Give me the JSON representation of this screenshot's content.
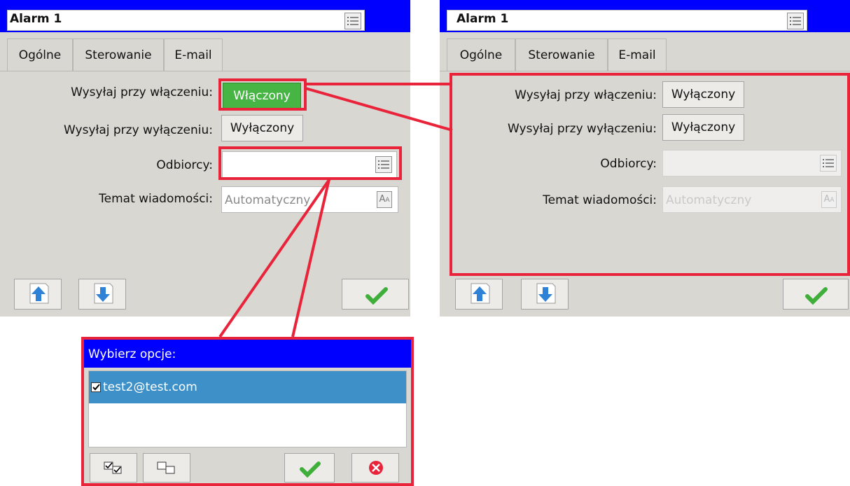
{
  "left_panel": {
    "title": "Alarm 1",
    "tabs": [
      "Ogólne",
      "Sterowanie",
      "E-mail"
    ],
    "active_tab": "E-mail",
    "fields": {
      "send_on_label": "Wysyłaj przy włączeniu:",
      "send_on_value": "Włączony",
      "send_off_label": "Wysyłaj przy wyłączeniu:",
      "send_off_value": "Wyłączony",
      "recipients_label": "Odbiorcy:",
      "recipients_value": "",
      "subject_label": "Temat wiadomości:",
      "subject_placeholder": "Automatyczny"
    }
  },
  "right_panel": {
    "title": "Alarm 1",
    "tabs": [
      "Ogólne",
      "Sterowanie",
      "E-mail"
    ],
    "active_tab": "E-mail",
    "fields": {
      "send_on_label": "Wysyłaj przy włączeniu:",
      "send_on_value": "Wyłączony",
      "send_off_label": "Wysyłaj przy wyłączeniu:",
      "send_off_value": "Wyłączony",
      "recipients_label": "Odbiorcy:",
      "recipients_value": "",
      "subject_label": "Temat wiadomości:",
      "subject_placeholder": "Automatyczny"
    }
  },
  "popup": {
    "title": "Wybierz opcje:",
    "items": [
      {
        "label": "test2@test.com",
        "checked": true,
        "selected": true
      }
    ]
  },
  "icons": {
    "up": "arrow-up-icon",
    "down": "arrow-down-icon",
    "ok": "checkmark-icon",
    "cancel": "cancel-icon",
    "list": "list-icon",
    "text": "text-format-icon",
    "select_all": "select-all-icon",
    "deselect_all": "deselect-all-icon"
  },
  "colors": {
    "title_bar": "#0000ff",
    "enabled_green": "#46b544",
    "selection_blue": "#3d90c8",
    "annotation_red": "#e8233a",
    "panel_bg": "#d9d7d2"
  }
}
